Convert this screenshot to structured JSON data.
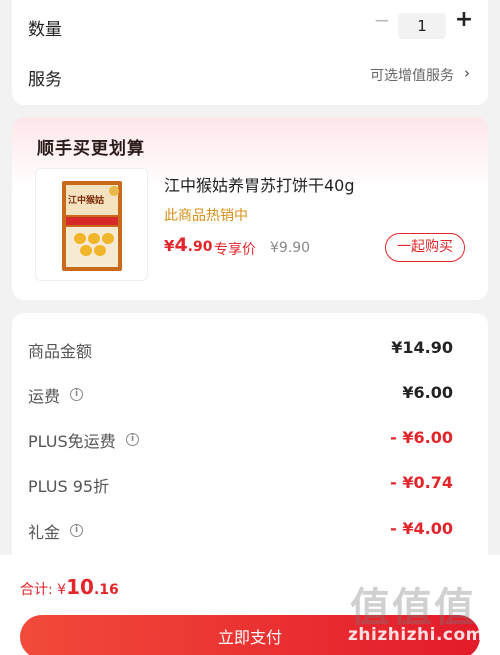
{
  "order": {
    "quantity_label": "数量",
    "quantity_minus": "−",
    "quantity_value": "1",
    "quantity_plus": "+",
    "service_label": "服务",
    "service_value": "可选增值服务",
    "service_chevron": "›"
  },
  "promo": {
    "title": "顺手买更划算",
    "product_name": "江中猴姑养胃苏打饼干40g",
    "hot_tag": "此商品热销中",
    "price_currency": "¥",
    "price_int": "4",
    "price_dec": ".90",
    "price_tag": "专享价",
    "original_price": "¥9.90",
    "buy_button": "一起购买",
    "image_logo_text": "江中猴姑"
  },
  "price_breakdown": {
    "rows": [
      {
        "label": "商品金额",
        "value": "¥14.90",
        "info": false,
        "accent": false
      },
      {
        "label": "运费",
        "value": "¥6.00",
        "info": true,
        "accent": false
      },
      {
        "label": "PLUS免运费",
        "value": "- ¥6.00",
        "info": true,
        "accent": true
      },
      {
        "label": "PLUS 95折",
        "value": "- ¥0.74",
        "info": false,
        "accent": true
      },
      {
        "label": "礼金",
        "value": "- ¥4.00",
        "info": true,
        "accent": true
      }
    ]
  },
  "footer": {
    "total_label": "合计:",
    "total_currency": "¥",
    "total_int": "10",
    "total_dec": ".16",
    "pay_button": "立即支付"
  },
  "watermark": {
    "glyphs": "值值值",
    "site": "zhizhizhi.com"
  },
  "colors": {
    "accent_red": "#e3262b",
    "hot_orange": "#d79018",
    "background": "#f2f2f2"
  }
}
